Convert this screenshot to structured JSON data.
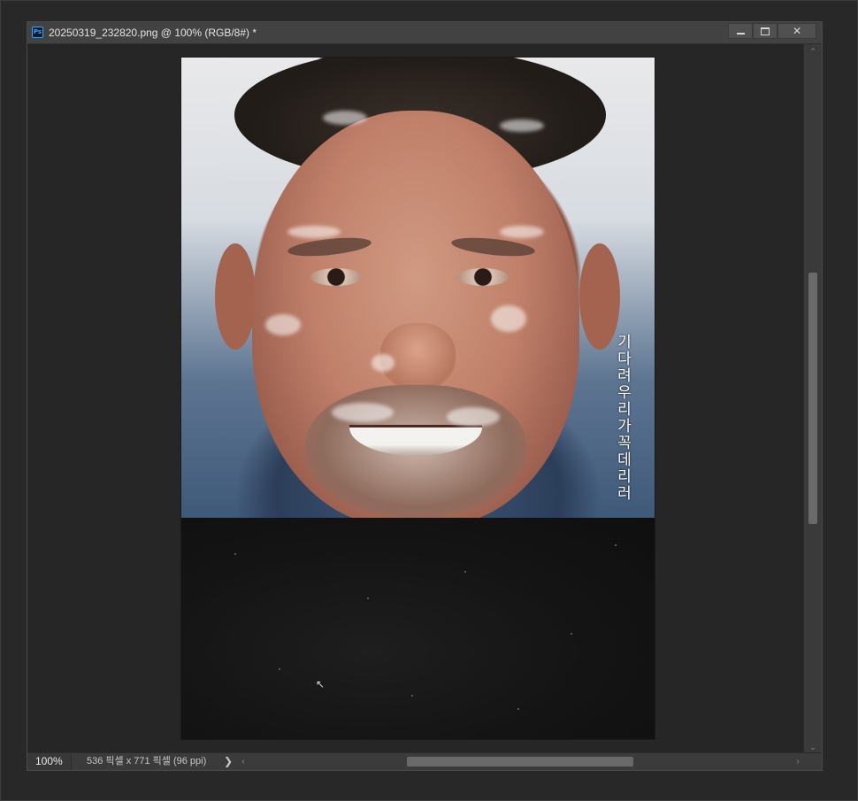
{
  "window": {
    "app_icon": "photoshop-icon",
    "app_icon_text": "Ps",
    "title": "20250319_232820.png @ 100% (RGB/8#) *",
    "controls": {
      "minimize": "minimize-icon",
      "restore": "restore-icon",
      "close": "close-icon",
      "close_glyph": "✕"
    }
  },
  "document": {
    "poster_vertical_text": "기다려 우리가 꼭 데리러",
    "cursor_glyph": "↖"
  },
  "statusbar": {
    "zoom": "100%",
    "doc_size": "536 픽셀 x 771 픽셀 (96 ppi)",
    "expand_glyph": "❯"
  },
  "scrollbars": {
    "up_glyph": "⌃",
    "down_glyph": "⌄",
    "left_glyph": "‹",
    "right_glyph": "›"
  },
  "colors": {
    "accent": "#31a8ff",
    "titlebar": "#424242",
    "canvas": "#262626"
  }
}
